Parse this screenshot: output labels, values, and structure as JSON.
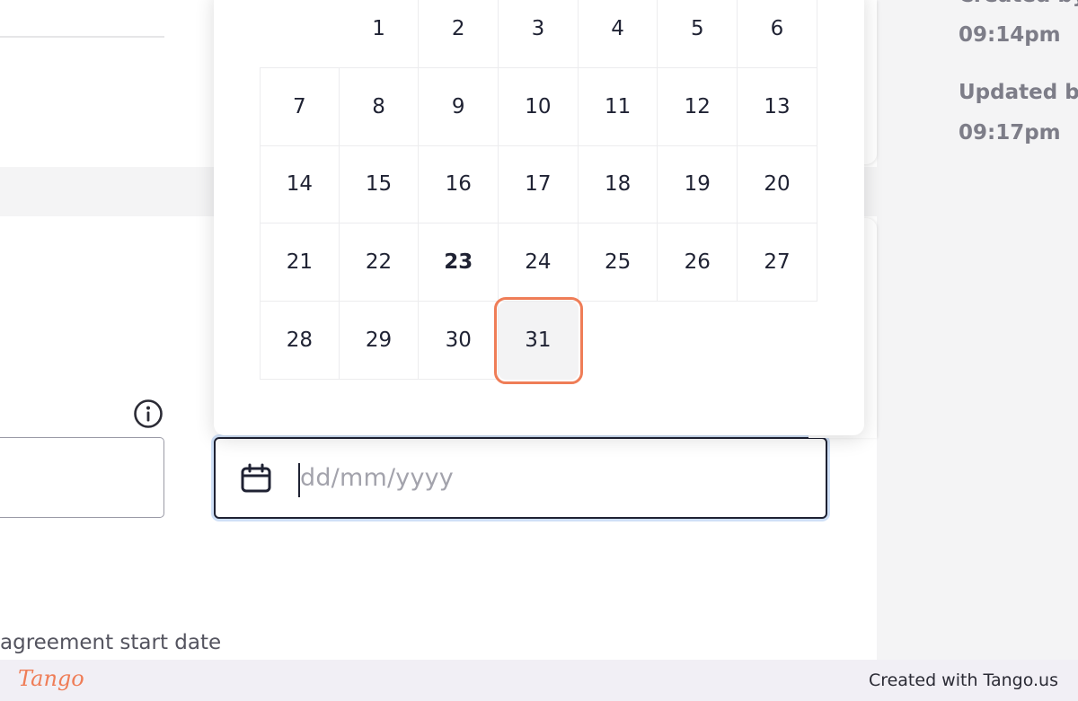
{
  "meta": {
    "created_partial": "Created by",
    "created_time": "09:14pm",
    "updated_label": "Updated b",
    "updated_time": "09:17pm"
  },
  "calendar": {
    "rows": [
      [
        "",
        "1",
        "2",
        "3",
        "4",
        "5",
        "6"
      ],
      [
        "7",
        "8",
        "9",
        "10",
        "11",
        "12",
        "13"
      ],
      [
        "14",
        "15",
        "16",
        "17",
        "18",
        "19",
        "20"
      ],
      [
        "21",
        "22",
        "23",
        "24",
        "25",
        "26",
        "27"
      ],
      [
        "28",
        "29",
        "30",
        "31",
        "",
        "",
        ""
      ]
    ],
    "today": "23",
    "highlighted": "31"
  },
  "date_field": {
    "placeholder": "dd/mm/yyyy",
    "icon": "calendar-icon"
  },
  "field_label": "agreement start date",
  "footer": {
    "logo": "Tango",
    "credit": "Created with Tango.us"
  },
  "colors": {
    "highlight": "#ef7d57",
    "focus_ring": "#cfe0f7",
    "text": "#1f2233"
  }
}
